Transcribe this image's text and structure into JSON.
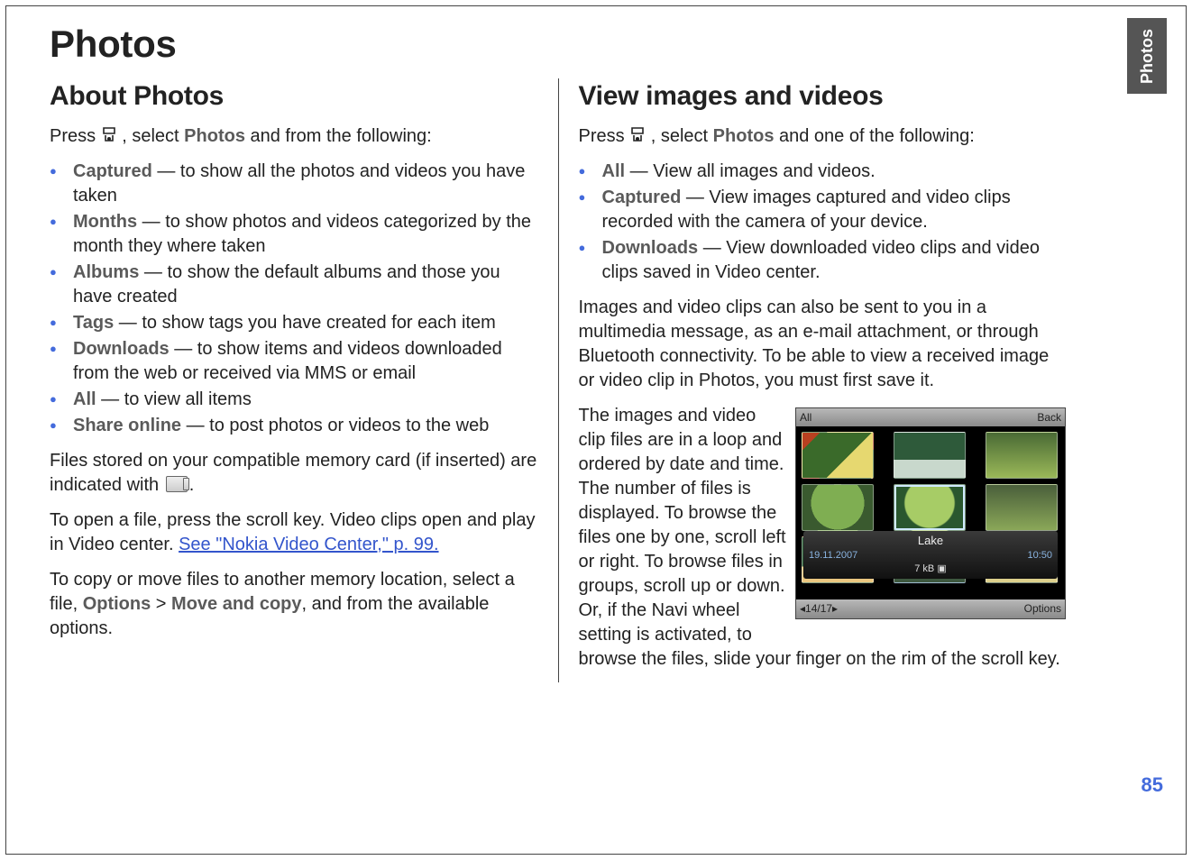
{
  "page_title": "Photos",
  "side_tab": "Photos",
  "page_number": "85",
  "left": {
    "heading": "About Photos",
    "intro_pre": "Press ",
    "intro_mid": ", select ",
    "intro_term": "Photos",
    "intro_post": " and from the following:",
    "items": [
      {
        "term": "Captured",
        "sep1": "  — ",
        "desc": "to show all the photos and videos you have taken"
      },
      {
        "term": "Months",
        "sep1": "  — ",
        "desc": "to show photos and videos categorized by the month they where taken"
      },
      {
        "term": "Albums",
        "sep1": "  — ",
        "desc": "to show the default albums and those you have created"
      },
      {
        "term": "Tags",
        "sep1": " — ",
        "desc": "to show tags you have created for each item"
      },
      {
        "term": "Downloads",
        "sep1": "  — ",
        "desc": "to show items and videos downloaded from the web or received via MMS or email"
      },
      {
        "term": "All",
        "sep1": "  — ",
        "desc": "to view all items"
      },
      {
        "term": "Share online",
        "sep1": "  — ",
        "desc": "to post photos or videos to the web"
      }
    ],
    "p2_pre": "Files stored on your compatible memory card (if inserted) are indicated with ",
    "p2_post": ".",
    "p3_pre": "To open a file, press the scroll key. Video clips open and play in Video center. ",
    "p3_link": "See \"Nokia Video Center,\" p. 99.",
    "p4_pre": "To copy or move files to another memory location, select a file, ",
    "p4_opt": "Options",
    "p4_gt": "  >  ",
    "p4_move": "Move and copy",
    "p4_post": ", and from the available options."
  },
  "right": {
    "heading": "View images and videos",
    "intro_pre": "Press ",
    "intro_mid": ", select ",
    "intro_term": "Photos",
    "intro_post": " and one of the following:",
    "items": [
      {
        "term": "All",
        "sep1": "  — ",
        "desc": "View all images and videos."
      },
      {
        "term": "Captured",
        "sep1": "  — ",
        "desc": "View images captured and video clips recorded with the camera of your device."
      },
      {
        "term": "Downloads",
        "sep1": "  — ",
        "desc": "View downloaded video clips and video clips saved in Video center."
      }
    ],
    "p2": "Images and video clips can also be sent to you in a multimedia message, as an e-mail attachment, or through Bluetooth connectivity. To be able to view a received image or video clip in Photos, you must first save it.",
    "p3": "The images and video clip files are in a loop and ordered by date and time. The number of files is displayed. To browse the files one by one, scroll left or right. To browse files in groups, scroll up or down. Or, if the Navi wheel setting is activated, to browse the files, slide your finger on the rim of the scroll key.",
    "screenshot": {
      "header_left": "All",
      "header_right": "Back",
      "caption_title": "Lake",
      "caption_date": "19.11.2007",
      "caption_time": "10:50",
      "caption_size": "7 kB",
      "footer_left": "◂14/17▸",
      "footer_right": "Options"
    }
  }
}
